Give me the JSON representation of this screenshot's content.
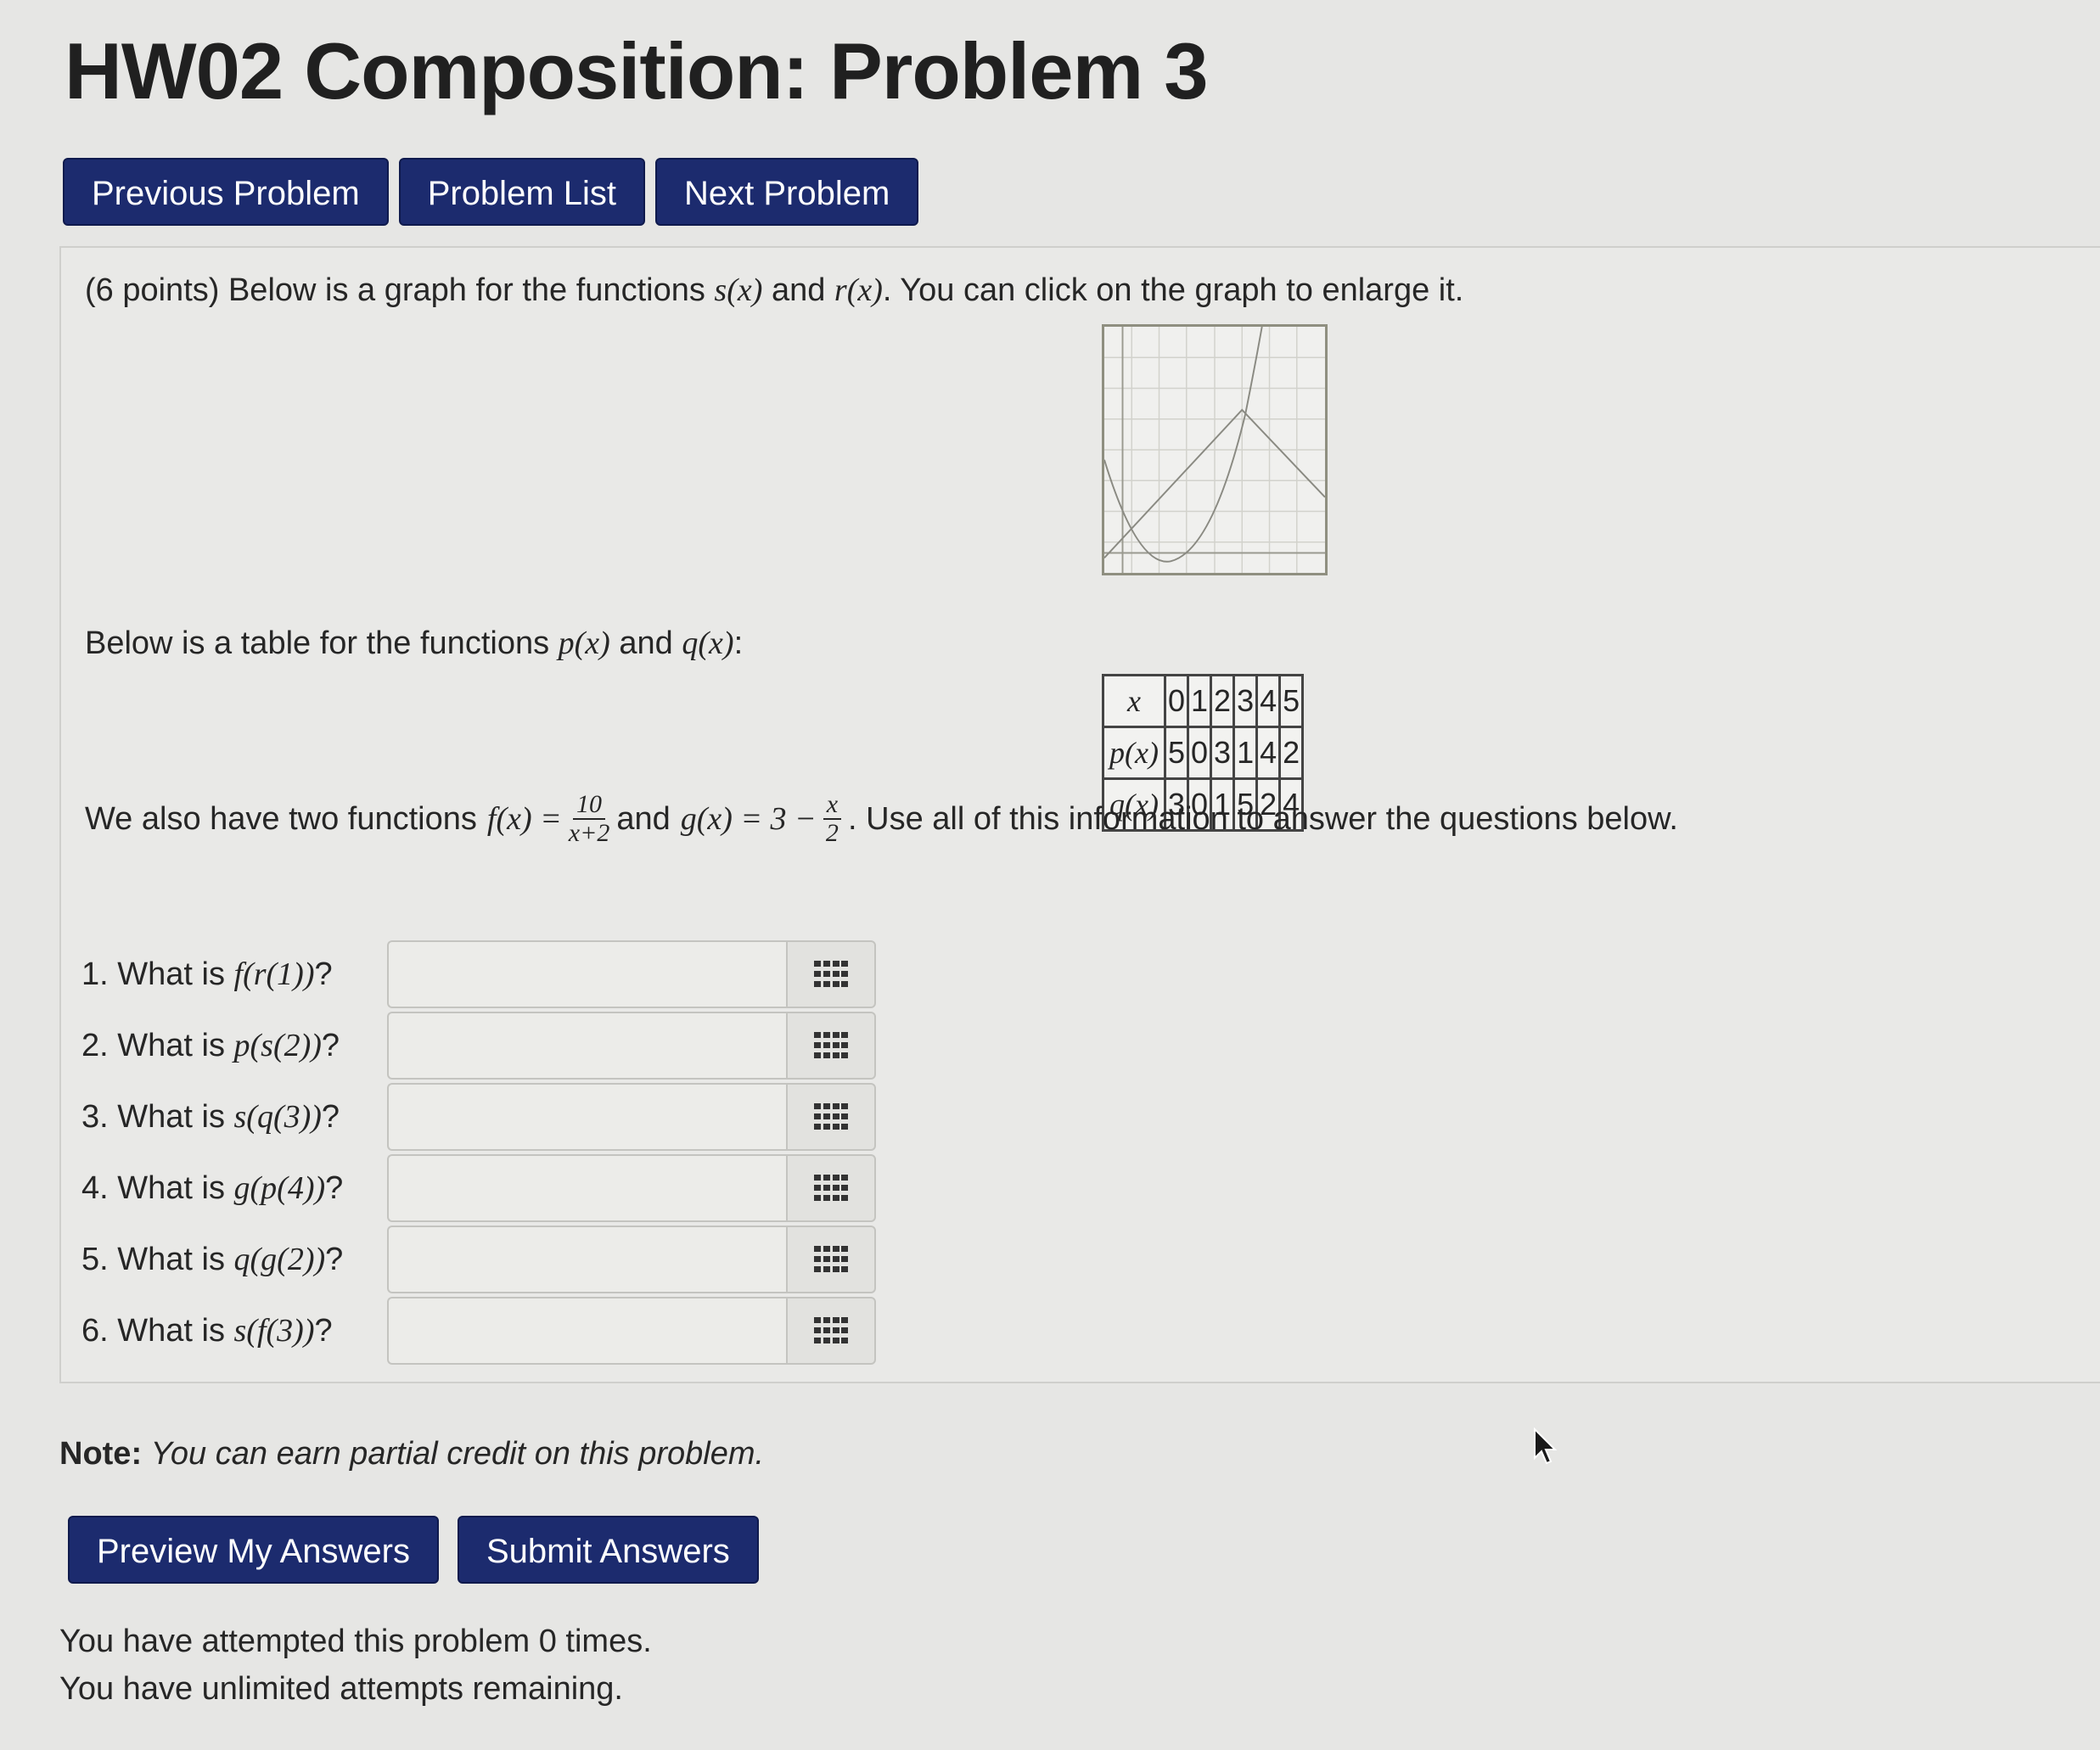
{
  "page": {
    "title": "HW02 Composition: Problem 3"
  },
  "nav": {
    "previous": "Previous Problem",
    "list": "Problem List",
    "next": "Next Problem"
  },
  "problem": {
    "intro": {
      "points": "(6 points) Below is a graph for the functions",
      "s": "s(x)",
      "and": "and",
      "r": "r(x)",
      "rest": ". You can click on the graph to enlarge it."
    },
    "table_intro": {
      "text": "Below is a table for the functions",
      "p": "p(x)",
      "and": "and",
      "q": "q(x)",
      "colon": ":"
    },
    "table": {
      "header_label": "x",
      "header": [
        "0",
        "1",
        "2",
        "3",
        "4",
        "5"
      ],
      "rows": [
        {
          "label": "p(x)",
          "values": [
            "5",
            "0",
            "3",
            "1",
            "4",
            "2"
          ]
        },
        {
          "label": "q(x)",
          "values": [
            "3",
            "0",
            "1",
            "5",
            "2",
            "4"
          ]
        }
      ]
    },
    "functions": {
      "lead": "We also have two functions",
      "f_lhs": "f(x) =",
      "f_num": "10",
      "f_den": "x+2",
      "and": "and",
      "g_lhs": "g(x) = 3 −",
      "g_num": "x",
      "g_den": "2",
      "tail": ". Use all of this information to answer the questions below."
    },
    "questions": [
      {
        "prefix": "1. What is",
        "expr": "f(r(1))",
        "suffix": "?"
      },
      {
        "prefix": "2. What is",
        "expr": "p(s(2))",
        "suffix": "?"
      },
      {
        "prefix": "3. What is",
        "expr": "s(q(3))",
        "suffix": "?"
      },
      {
        "prefix": "4. What is",
        "expr": "g(p(4))",
        "suffix": "?"
      },
      {
        "prefix": "5. What is",
        "expr": "q(g(2))",
        "suffix": "?"
      },
      {
        "prefix": "6. What is",
        "expr": "s(f(3))",
        "suffix": "?"
      }
    ],
    "palette_icon": "grid-dots-icon"
  },
  "note": {
    "label": "Note:",
    "text": "You can earn partial credit on this problem."
  },
  "actions": {
    "preview": "Preview My Answers",
    "submit": "Submit Answers"
  },
  "status": {
    "attempted": "You have attempted this problem 0 times.",
    "remaining": "You have unlimited attempts remaining."
  },
  "colors": {
    "button": "#1c2b6e",
    "background": "#e6e6e4",
    "panel": "#e9e9e7"
  }
}
